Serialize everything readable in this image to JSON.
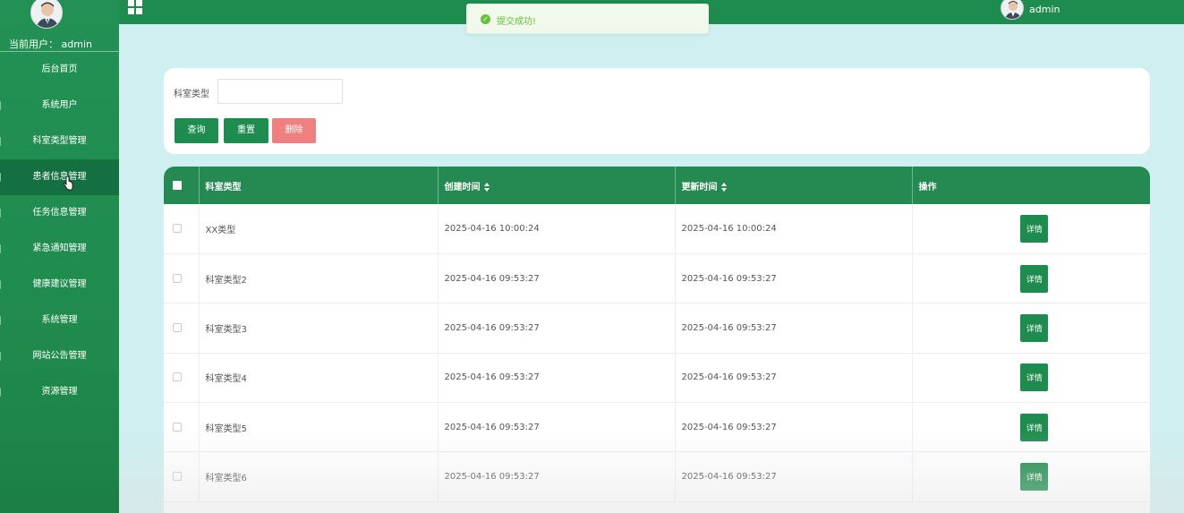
{
  "sidebar": {
    "current_user_label": "当前用户：",
    "current_user_name": "admin",
    "items": [
      {
        "label": "后台首页"
      },
      {
        "label": "系统用户"
      },
      {
        "label": "科室类型管理"
      },
      {
        "label": "患者信息管理",
        "active": true
      },
      {
        "label": "任务信息管理"
      },
      {
        "label": "紧急通知管理"
      },
      {
        "label": "健康建议管理"
      },
      {
        "label": "系统管理"
      },
      {
        "label": "网站公告管理"
      },
      {
        "label": "资源管理"
      }
    ]
  },
  "topbar": {
    "user_name": "admin"
  },
  "toast": {
    "message": "提交成功!",
    "color": "#67c23a"
  },
  "search": {
    "field_label": "科室类型",
    "field_value": "",
    "query_label": "查询",
    "reset_label": "重置",
    "delete_label": "删除"
  },
  "table": {
    "columns": [
      "科室类型",
      "创建时间",
      "更新时间",
      "操作"
    ],
    "rows": [
      {
        "type": "XX类型",
        "created": "2025-04-16 10:00:24",
        "updated": "2025-04-16 10:00:24",
        "action": "详情"
      },
      {
        "type": "科室类型2",
        "created": "2025-04-16 09:53:27",
        "updated": "2025-04-16 09:53:27",
        "action": "详情"
      },
      {
        "type": "科室类型3",
        "created": "2025-04-16 09:53:27",
        "updated": "2025-04-16 09:53:27",
        "action": "详情"
      },
      {
        "type": "科室类型4",
        "created": "2025-04-16 09:53:27",
        "updated": "2025-04-16 09:53:27",
        "action": "详情"
      },
      {
        "type": "科室类型5",
        "created": "2025-04-16 09:53:27",
        "updated": "2025-04-16 09:53:27",
        "action": "详情"
      },
      {
        "type": "科室类型6",
        "created": "2025-04-16 09:53:27",
        "updated": "2025-04-16 09:53:27",
        "action": "详情"
      }
    ]
  },
  "colors": {
    "primary": "#1f8c4f",
    "danger": "#f08080",
    "background": "#cfeff0"
  }
}
